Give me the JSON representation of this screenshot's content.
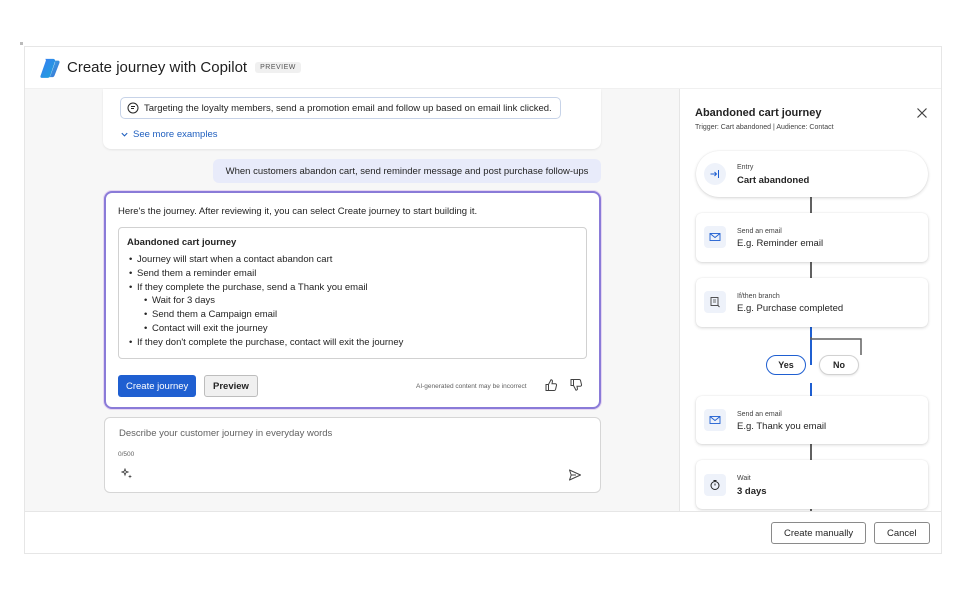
{
  "header": {
    "title": "Create journey with Copilot",
    "badge": "PREVIEW"
  },
  "chat": {
    "example_prompt": "Targeting the loyalty members, send a promotion email and follow up based on email link clicked.",
    "see_more": "See more examples",
    "user_message": "When customers abandon cart, send reminder message and post purchase follow-ups",
    "response": {
      "intro": "Here's the journey. After reviewing it, you can select Create journey to start building it.",
      "summary_title": "Abandoned cart journey",
      "steps": [
        {
          "text": "Journey will start when a contact abandon cart",
          "level": 0
        },
        {
          "text": "Send them a reminder email",
          "level": 0
        },
        {
          "text": "If they complete the purchase, send a Thank you email",
          "level": 0
        },
        {
          "text": "Wait for 3 days",
          "level": 1
        },
        {
          "text": "Send them a Campaign email",
          "level": 1
        },
        {
          "text": "Contact will exit the journey",
          "level": 1
        },
        {
          "text": "If they don't complete the purchase, contact will exit the journey",
          "level": 0
        }
      ],
      "create_button": "Create journey",
      "preview_button": "Preview",
      "disclaimer": "AI-generated content may be incorrect"
    },
    "input": {
      "placeholder": "Describe your customer journey in everyday words",
      "char_count": "0/500"
    }
  },
  "flow": {
    "title": "Abandoned cart journey",
    "subtitle": "Trigger: Cart abandoned  |  Audience: Contact",
    "nodes": {
      "entry": {
        "label": "Entry",
        "value": "Cart abandoned",
        "icon": "entry-arrow-icon"
      },
      "reminder": {
        "label": "Send an email",
        "value": "E.g. Reminder email",
        "icon": "mail-icon"
      },
      "branch": {
        "label": "If/then branch",
        "value": "E.g. Purchase completed",
        "icon": "branch-icon"
      },
      "thankyou": {
        "label": "Send an email",
        "value": "E.g. Thank you email",
        "icon": "mail-icon"
      },
      "wait": {
        "label": "Wait",
        "value": "3 days",
        "icon": "timer-icon"
      }
    },
    "branch_yes": "Yes",
    "branch_no": "No"
  },
  "footer": {
    "create_manually": "Create manually",
    "cancel": "Cancel"
  },
  "colors": {
    "primary": "#1f5fd1",
    "link": "#1f5fbf",
    "response_border": "#8a7bd8",
    "user_bubble": "#e8ebfa"
  }
}
